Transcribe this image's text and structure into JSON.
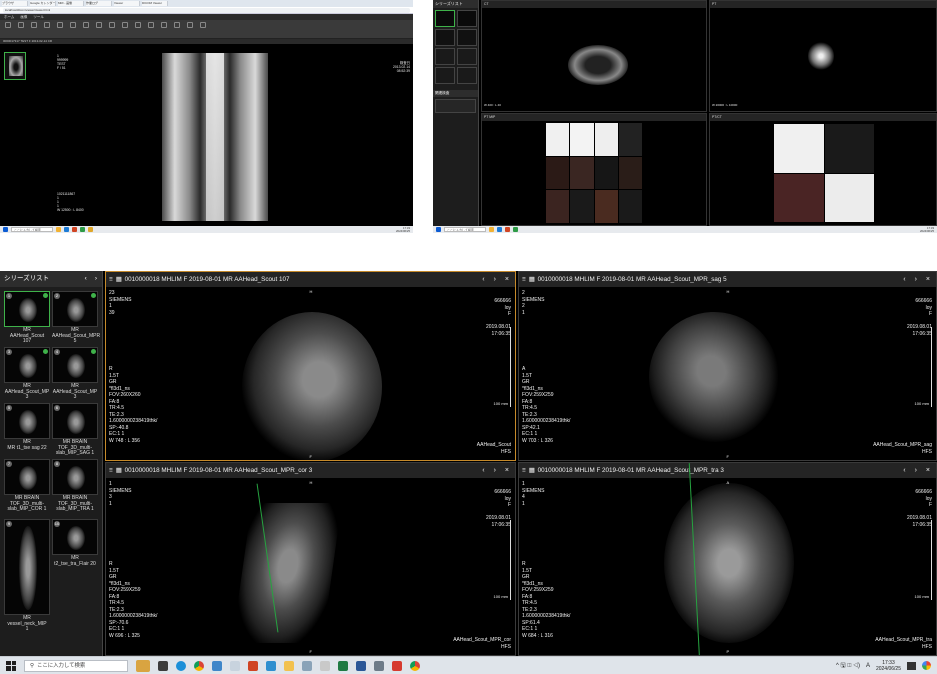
{
  "shot1": {
    "tabs": [
      "ブラウザ",
      "Google カレンダー",
      "MRI - 画像",
      "作業ログ",
      "Viewer",
      "DICOM Viewer"
    ],
    "url": "localhost/dicomviewer/viewer.html",
    "menu": [
      "ホーム",
      "画像",
      "ツール"
    ],
    "series_bar": "0000017317 TEST F 2013-02-14 CR",
    "overlay_tl": "1\n999999\nTEST\nF / 51",
    "overlay_tr": "検査日\n2013.02.14\n08:52:39",
    "overlay_bl": "1021111867\n1\n1\n1\nW 12500 : L 8400",
    "taskbar_search": "ここに入力して検索",
    "clock": "17:33\n2024/06/25"
  },
  "shot2": {
    "sidebar_title": "シリーズリスト",
    "sidebar_title2": "関連検査",
    "vp1_head": "CT",
    "vp2_head": "PT",
    "vp3_head": "PT MIP",
    "vp4_head": "PT/CT",
    "overlay_vp1_bl": "W 400 : L 40",
    "overlay_vp2_bl": "W 20000 : L 10000",
    "taskbar_search": "ここに入力して検索",
    "clock": "17:33\n2024/06/25"
  },
  "main": {
    "sidebar": {
      "title": "シリーズリスト",
      "nav_prev": "‹",
      "nav_next": "›",
      "thumbs": [
        {
          "num": "1",
          "label": "MR\nAAHead_Scout\n107",
          "selected": true,
          "dot": true
        },
        {
          "num": "2",
          "label": "MR\nAAHead_Scout_MPR\n5",
          "selected": false,
          "dot": true
        },
        {
          "num": "3",
          "label": "MR\nAAHead_Scout_MP\n3",
          "selected": false,
          "dot": true
        },
        {
          "num": "4",
          "label": "MR\nAAHead_Scout_MP\n3",
          "selected": false,
          "dot": true
        },
        {
          "num": "5",
          "label": "MR\nMR t1_tse sag 22",
          "selected": false,
          "dot": false
        },
        {
          "num": "6",
          "label": "MR BRAIN\nTOF_3D_multi-\nslab_MIP_SAG 1",
          "selected": false,
          "dot": false
        },
        {
          "num": "7",
          "label": "MR BRAIN\nTOF_3D_multi-\nslab_MIP_COR 1",
          "selected": false,
          "dot": false
        },
        {
          "num": "8",
          "label": "MR BRAIN\nTOF_3D_multi-\nslab_MIP_TRA 1",
          "selected": false,
          "dot": false
        },
        {
          "num": "9",
          "label": "MR\nvessel_neck_MIP\n1",
          "selected": false,
          "dot": false
        },
        {
          "num": "10",
          "label": "MR\nt2_tse_tra_Flair 20",
          "selected": false,
          "dot": false
        }
      ]
    },
    "viewports": [
      {
        "title": "0010000018 MHLIM F 2019-08-01 MR AAHead_Scout 107",
        "tl": "23\nSIEMENS\n1\n39",
        "tr": "666666\nloy\nF\n\n2019.08.01\n17:06:35",
        "ml": "R\n1.5T\nGR\n*fl3d1_ns\nFOV:260X260\nFA:8\nTR:4.5\nTE:2.3\n1.6000000238419thk/\nSP:-40.8\nEC:1 1\nW 748 : L 356",
        "br": "AAHead_Scout\nHFS",
        "scale": "100 mm",
        "top": "H",
        "bottom": "F"
      },
      {
        "title": "0010000018 MHLIM F 2019-08-01 MR AAHead_Scout_MPR_sag 5",
        "tl": "2\nSIEMENS\n2\n1",
        "tr": "666666\nloy\nF\n\n2019.08.01\n17:06:35",
        "ml": "A\n1.5T\nGR\n*fl3d1_ns\nFOV:259X259\nFA:8\nTR:4.5\nTE:2.3\n1.6000000238419thk/\nSP:42.1\nEC:1 1\nW 703 : L 326",
        "br": "AAHead_Scout_MPR_sag\nHFS",
        "scale": "100 mm",
        "top": "H",
        "bottom": "F"
      },
      {
        "title": "0010000018 MHLIM F 2019-08-01 MR AAHead_Scout_MPR_cor 3",
        "tl": "1\nSIEMENS\n3\n1",
        "tr": "666666\nloy\nF\n\n2019.08.01\n17:06:35",
        "ml": "R\n1.5T\nGR\n*fl3d1_ns\nFOV:259X259\nFA:8\nTR:4.5\nTE:2.3\n1.6000000238419thk/\nSP:-70.6\nEC:1 1\nW 696 : L 325",
        "br": "AAHead_Scout_MPR_cor\nHFS",
        "scale": "100 mm",
        "top": "H",
        "bottom": "F"
      },
      {
        "title": "0010000018 MHLIM F 2019-08-01 MR AAHead_Scout_MPR_tra 3",
        "tl": "1\nSIEMENS\n4\n1",
        "tr": "666666\nloy\nF\n\n2019.08.01\n17:06:35",
        "ml": "R\n1.5T\nGR\n*fl3d1_ns\nFOV:259X259\nFA:8\nTR:4.5\nTE:2.3\n1.6000000238419thk/\nSP:61.4\nEC:1 1\nW 684 : L 316",
        "br": "AAHead_Scout_MPR_tra\nHFS",
        "scale": "100 mm",
        "top": "A",
        "bottom": "P"
      }
    ],
    "vp_controls": {
      "menu": "≡",
      "layout": "▦",
      "prev": "‹",
      "next": "›",
      "close": "×"
    },
    "taskbar": {
      "search": "ここに入力して検索",
      "time": "17:33",
      "date": "2024/06/25",
      "ime": "A",
      "tray": "^ 🖫 ◫ ◁)"
    }
  },
  "colors": {
    "active_border": "#c68a2a",
    "series_dot": "#3fb24a",
    "viewer_bg": "#000000"
  }
}
